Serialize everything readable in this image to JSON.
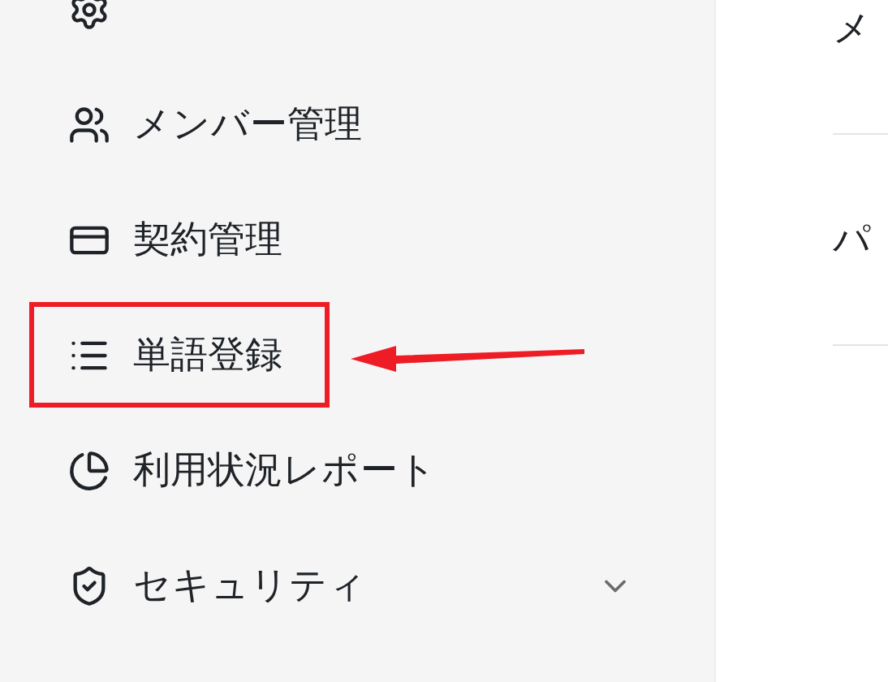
{
  "sidebar": {
    "items": [
      {
        "highlighted": false
      },
      {
        "label": "メンバー管理",
        "highlighted": false
      },
      {
        "label": "契約管理",
        "highlighted": false
      },
      {
        "label": "単語登録",
        "highlighted": true,
        "pointed": true
      },
      {
        "label": "利用状況レポート",
        "highlighted": false
      },
      {
        "label": "セキュリティ",
        "highlighted": false,
        "expandable": true,
        "expanded": false
      }
    ]
  },
  "content": {
    "rows": [
      {
        "label": "メ"
      },
      {
        "label": "パ"
      }
    ]
  }
}
